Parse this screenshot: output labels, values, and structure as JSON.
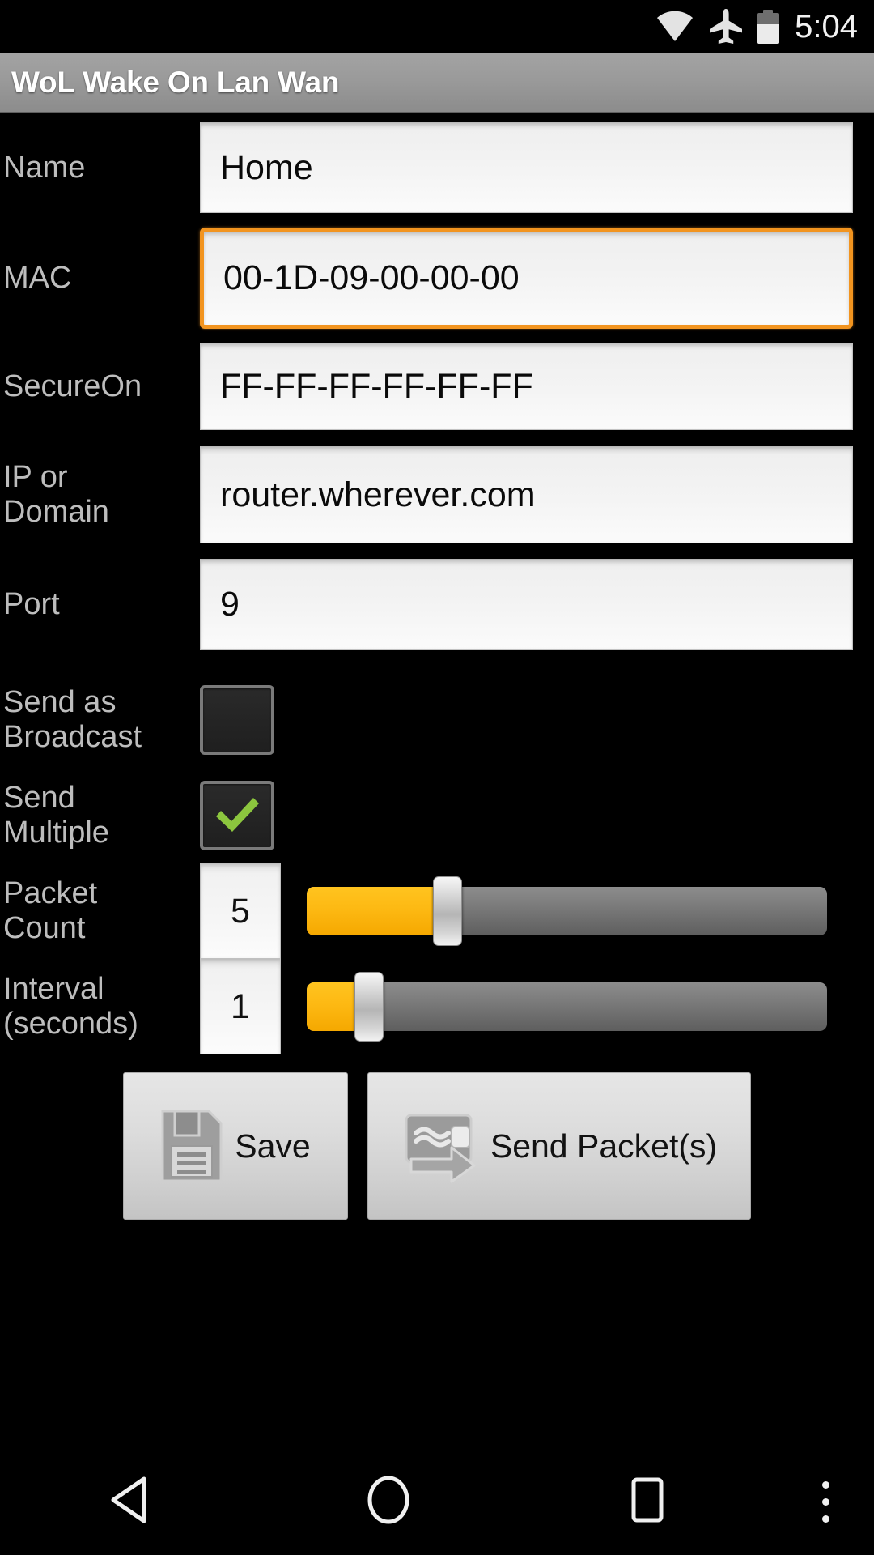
{
  "status_bar": {
    "wifi_icon": "wifi-icon",
    "airplane_icon": "airplane-mode-icon",
    "battery_icon": "battery-icon",
    "time": "5:04"
  },
  "action_bar": {
    "title": "WoL Wake On Lan Wan"
  },
  "form": {
    "fields": [
      {
        "label": "Name",
        "value": "Home",
        "focused": false
      },
      {
        "label": "MAC",
        "value": "00-1D-09-00-00-00",
        "focused": true
      },
      {
        "label": "SecureOn",
        "value": "FF-FF-FF-FF-FF-FF",
        "focused": false
      },
      {
        "label": "IP or\nDomain",
        "value": "router.wherever.com",
        "focused": false
      },
      {
        "label": "Port",
        "value": "9",
        "focused": false
      }
    ],
    "checkboxes": [
      {
        "label": "Send as\nBroadcast",
        "checked": false
      },
      {
        "label": "Send\nMultiple",
        "checked": true
      }
    ],
    "sliders": [
      {
        "label": "Packet\nCount",
        "value": "5",
        "percent": 27
      },
      {
        "label": "Interval\n(seconds)",
        "value": "1",
        "percent": 12
      }
    ]
  },
  "buttons": {
    "save": {
      "label": "Save",
      "icon": "floppy-disk-icon"
    },
    "send": {
      "label": "Send Packet(s)",
      "icon": "send-packet-icon"
    }
  },
  "nav_bar": {
    "back": "back-triangle-icon",
    "home": "home-circle-icon",
    "recents": "recents-square-icon",
    "overflow": "overflow-menu-icon"
  },
  "colors": {
    "accent_focus": "#f2941f",
    "slider_fill": "#fdb913",
    "checkmark": "#8cc63e",
    "label_text": "#bdbdbd",
    "background": "#000000"
  }
}
